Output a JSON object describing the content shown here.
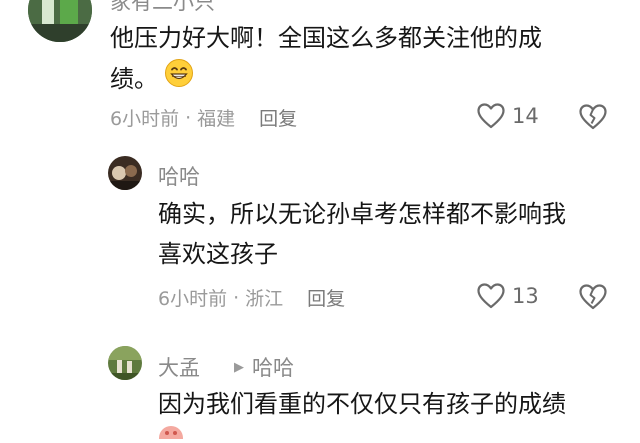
{
  "comments": [
    {
      "username": "家有二小只",
      "text_line1": "他压力好大啊！全国这么多都关注他的成",
      "text_line2": "绩。",
      "emoji": "grin-emoji",
      "time": "6小时前",
      "location": "福建",
      "reply_label": "回复",
      "likes": "14"
    },
    {
      "username": "哈哈",
      "text_line1": "确实，所以无论孙卓考怎样都不影响我",
      "text_line2": "喜欢这孩子",
      "time": "6小时前",
      "location": "浙江",
      "reply_label": "回复",
      "likes": "13"
    },
    {
      "username": "大孟",
      "reply_arrow": "▶",
      "reply_to": "哈哈",
      "text_line1": "因为我们看重的不仅仅只有孩子的成绩"
    }
  ],
  "colors": {
    "meta": "#9a9a9a",
    "icon": "#6a6a6a",
    "text": "#161616"
  }
}
